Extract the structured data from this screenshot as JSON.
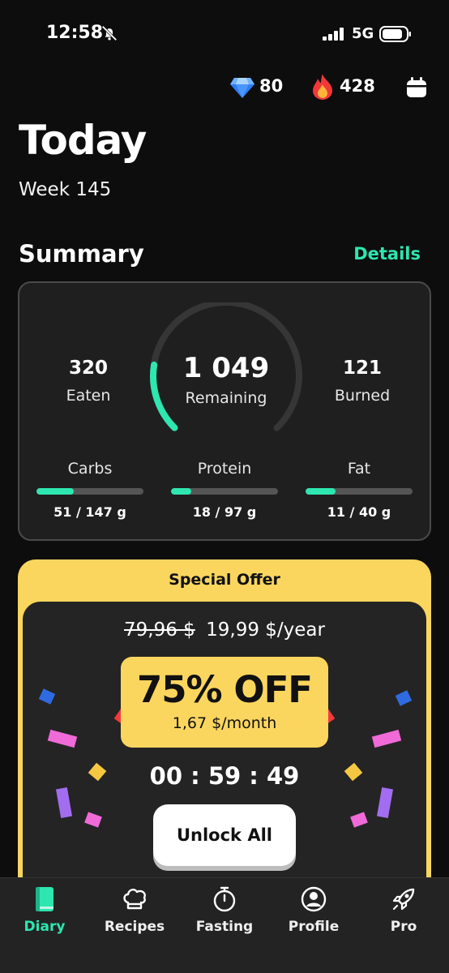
{
  "status_bar": {
    "time": "12:58",
    "network": "5G"
  },
  "header": {
    "gems": "80",
    "streak": "428"
  },
  "page": {
    "title": "Today",
    "week": "Week 145"
  },
  "summary": {
    "title": "Summary",
    "details_label": "Details",
    "eaten": "320",
    "eaten_label": "Eaten",
    "remaining": "1 049",
    "remaining_label": "Remaining",
    "burned": "121",
    "burned_label": "Burned",
    "remaining_progress": 0.2,
    "macros": [
      {
        "label": "Carbs",
        "value": "51 / 147 g",
        "progress": 0.35
      },
      {
        "label": "Protein",
        "value": "18 / 97 g",
        "progress": 0.19
      },
      {
        "label": "Fat",
        "value": "11 / 40 g",
        "progress": 0.28
      }
    ]
  },
  "offer": {
    "header": "Special Offer",
    "old_price": "79,96 $",
    "new_price": "19,99 $/year",
    "discount": "75% OFF",
    "monthly": "1,67 $/month",
    "countdown": "00 : 59 : 49",
    "button_label": "Unlock All"
  },
  "tabs": [
    {
      "label": "Diary",
      "icon": "book-icon",
      "active": true
    },
    {
      "label": "Recipes",
      "icon": "chef-hat-icon",
      "active": false
    },
    {
      "label": "Fasting",
      "icon": "stopwatch-icon",
      "active": false
    },
    {
      "label": "Profile",
      "icon": "user-circle-icon",
      "active": false
    },
    {
      "label": "Pro",
      "icon": "rocket-icon",
      "active": false
    }
  ],
  "colors": {
    "accent": "#2ee6b0",
    "offer_yellow": "#fbd65f",
    "background": "#0d0d0d",
    "card": "#1f1f1f"
  }
}
